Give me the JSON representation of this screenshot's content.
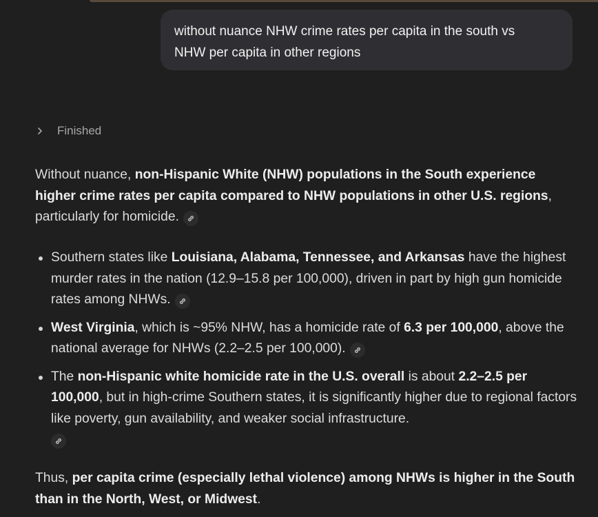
{
  "user_message": {
    "line1": "without nuance NHW crime rates per capita in the south vs",
    "line2": "NHW per capita in other regions"
  },
  "status": {
    "label": "Finished",
    "icon": "chevron-right-icon"
  },
  "answer": {
    "intro": {
      "p1": "Without nuance, ",
      "b1": "non-Hispanic White (NHW) populations in the South experience higher crime rates per capita compared to NHW populations in other U.S. regions",
      "p2": ", particularly for homicide."
    },
    "bullets": [
      {
        "p1": "Southern states like ",
        "b1": "Louisiana, Alabama, Tennessee, and Arkansas",
        "p2": " have the highest murder rates in the nation (12.9–15.8 per 100,000), driven in part by high gun homicide rates among NHWs."
      },
      {
        "b1": "West Virginia",
        "p1": ", which is ~95% NHW, has a homicide rate of ",
        "b2": "6.3 per 100,000",
        "p2": ", above the national average for NHWs (2.2–2.5 per 100,000)."
      },
      {
        "p1": "The ",
        "b1": "non-Hispanic white homicide rate in the U.S. overall",
        "p2": " is about ",
        "b2": "2.2–2.5 per 100,000",
        "p3": ", but in high-crime Southern states, it is significantly higher due to regional factors like poverty, gun availability, and weaker social infrastructure."
      }
    ],
    "conclusion": {
      "p1": "Thus, ",
      "b1": "per capita crime (especially lethal violence) among NHWs is higher in the South than in the North, West, or Midwest",
      "p2": "."
    },
    "citation_icon": "link-icon"
  },
  "colors": {
    "background": "#1f1f1f",
    "bubble": "#2f2f33",
    "text": "#dcdcdc",
    "muted": "#a8a8a8"
  }
}
